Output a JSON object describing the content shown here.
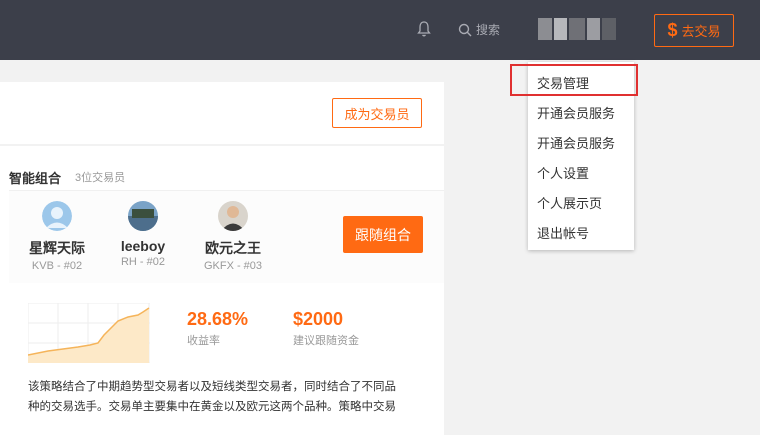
{
  "topbar": {
    "search_label": "搜索",
    "go_trade_symbol": "$",
    "go_trade_label": "去交易"
  },
  "header": {
    "become_trader_label": "成为交易员"
  },
  "combo": {
    "title": "智能组合",
    "subtitle": "3位交易员",
    "follow_label": "跟随组合",
    "traders": [
      {
        "name": "星辉天际",
        "code": "KVB - #02"
      },
      {
        "name": "leeboy",
        "code": "RH - #02"
      },
      {
        "name": "欧元之王",
        "code": "GKFX - #03"
      }
    ],
    "stats": {
      "return_value": "28.68%",
      "return_label": "收益率",
      "funds_value": "$2000",
      "funds_label": "建议跟随资金"
    },
    "description_line1": "该策略结合了中期趋势型交易者以及短线类型交易者，同时结合了不同品",
    "description_line2": "种的交易选手。交易单主要集中在黄金以及欧元这两个品种。策略中交易"
  },
  "dropdown": {
    "items": [
      {
        "label": "交易管理"
      },
      {
        "label": "开通会员服务"
      },
      {
        "label": "开通会员服务"
      },
      {
        "label": "个人设置"
      },
      {
        "label": "个人展示页"
      },
      {
        "label": "退出帐号"
      }
    ]
  },
  "colors": {
    "accent": "#ff6a13",
    "topbar_bg": "#3c3f4a",
    "highlight": "#e03030"
  }
}
